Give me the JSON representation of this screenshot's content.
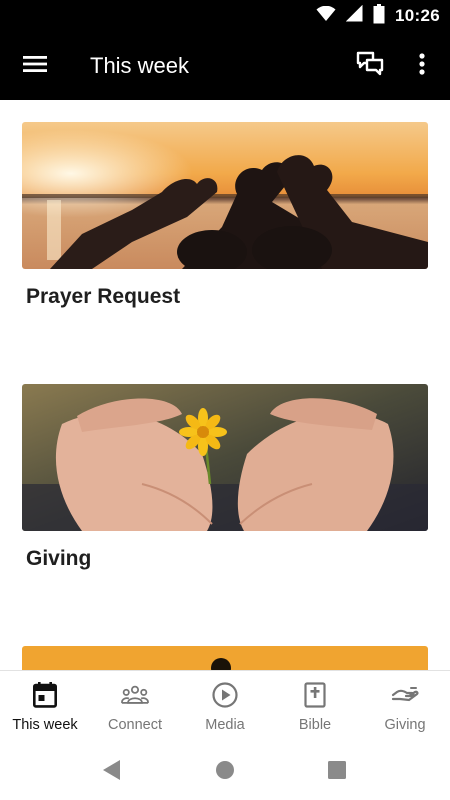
{
  "status_bar": {
    "time": "10:26"
  },
  "app_bar": {
    "title": "This week"
  },
  "cards": [
    {
      "title": "Prayer Request"
    },
    {
      "title": "Giving"
    }
  ],
  "bottom_nav": {
    "items": [
      {
        "label": "This week",
        "icon": "calendar-icon",
        "active": true
      },
      {
        "label": "Connect",
        "icon": "people-icon",
        "active": false
      },
      {
        "label": "Media",
        "icon": "play-circle-icon",
        "active": false
      },
      {
        "label": "Bible",
        "icon": "bible-icon",
        "active": false
      },
      {
        "label": "Giving",
        "icon": "giving-hand-icon",
        "active": false
      }
    ]
  },
  "colors": {
    "app_bar": "#000000",
    "active_nav": "#111111",
    "inactive_nav": "#767676"
  }
}
